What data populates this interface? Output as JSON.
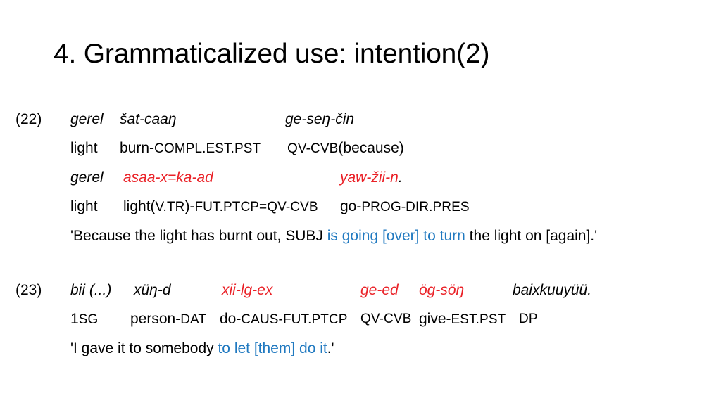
{
  "slide": {
    "title": "4. Grammaticalized use: intention(2)",
    "colors": {
      "highlight_red": "#EA2127",
      "highlight_blue": "#2079C0",
      "text_black": "#000000",
      "background": "#FFFFFF"
    }
  },
  "examples": [
    {
      "number": "(22)",
      "vernacular_line_1": {
        "col1": "gerel",
        "col2": "šat-caaŋ",
        "col3": "ge-seŋ-čin"
      },
      "gloss_line_1": {
        "col1": "light",
        "col2_stem": "burn-",
        "col2_tags": "COMPL.EST.PST",
        "col3_tags": "QV-CVB",
        "col3_paren": "(because)"
      },
      "vernacular_line_2": {
        "col1": "gerel",
        "col2": "asaa-x=ka-ad",
        "col3": "yaw-žii-n",
        "col3_period": "."
      },
      "gloss_line_2": {
        "col1": "light",
        "col2_stem": "light(",
        "col2_tag_a": "V.TR",
        "col2_mid": ")-",
        "col2_tag_b": "FUT.PTCP=QV-CVB",
        "col3_stem": "go-",
        "col3_tags": "PROG-DIR.PRES"
      },
      "translation": {
        "part1": "'Because the light has burnt out, SUBJ ",
        "highlight": "is going [over] to turn",
        "part2": " the light on [again].'"
      }
    },
    {
      "number": "(23)",
      "vernacular_line_1": {
        "col1": "bii (...)",
        "col2": "xüŋ-d",
        "col3": "xii-lg-ex",
        "col4": "ge-ed",
        "col5": "ög-söŋ",
        "col6": "baixkuuyüü."
      },
      "gloss_line_1": {
        "col1_num": "1",
        "col1_tags": "SG",
        "col2_stem": "person-",
        "col2_tags": "DAT",
        "col3_stem": "do-",
        "col3_tags": "CAUS-FUT.PTCP",
        "col4_tags": "QV-CVB",
        "col5_stem": "give-",
        "col5_tags": "EST.PST",
        "col6_tags": "DP"
      },
      "translation": {
        "part1": "'I gave it to somebody ",
        "highlight": "to let [them] do it",
        "part2": ".'"
      }
    }
  ]
}
